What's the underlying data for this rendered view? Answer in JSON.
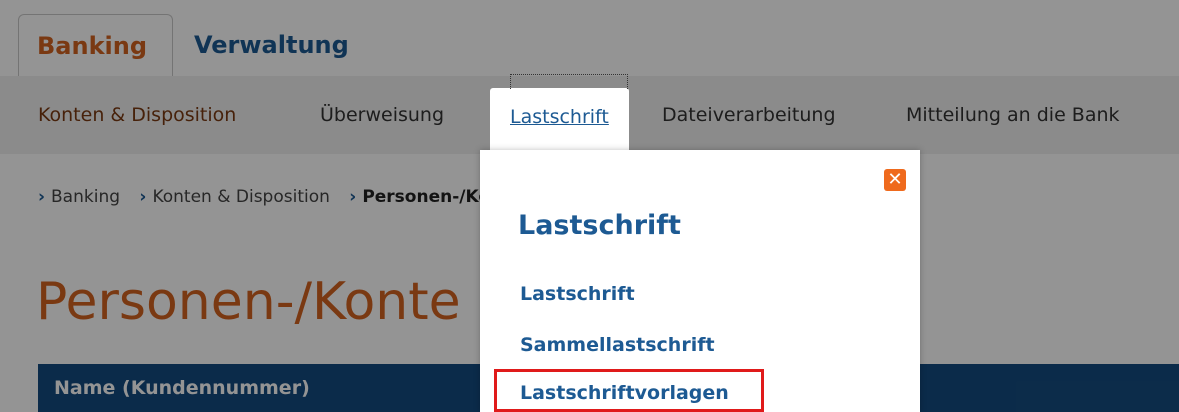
{
  "top_tabs": [
    {
      "label": "Banking",
      "active": true
    },
    {
      "label": "Verwaltung",
      "active": false
    }
  ],
  "subnav": [
    {
      "label": "Konten & Disposition"
    },
    {
      "label": "Überweisung"
    },
    {
      "label": "Lastschrift",
      "active": true
    },
    {
      "label": "Dateiverarbeitung"
    },
    {
      "label": "Mitteilung an die Bank"
    }
  ],
  "breadcrumb": [
    "Banking",
    "Konten & Disposition",
    "Personen-/Konte"
  ],
  "page_title": "Personen-/Konte",
  "table": {
    "header_name": "Name (Kundennummer)"
  },
  "dropdown": {
    "title": "Lastschrift",
    "close_symbol": "✕",
    "links": [
      "Lastschrift",
      "Sammellastschrift",
      "Lastschriftvorlagen"
    ],
    "highlighted": "Lastschriftvorlagen"
  },
  "colors": {
    "brand_orange": "#d2621f",
    "brand_blue": "#1d5a93",
    "table_header": "#144b80",
    "highlight_red": "#e01a1a",
    "close_orange": "#ef6a1d"
  },
  "icons": {
    "breadcrumb_separator": "chevron-right-icon",
    "close": "close-icon"
  }
}
